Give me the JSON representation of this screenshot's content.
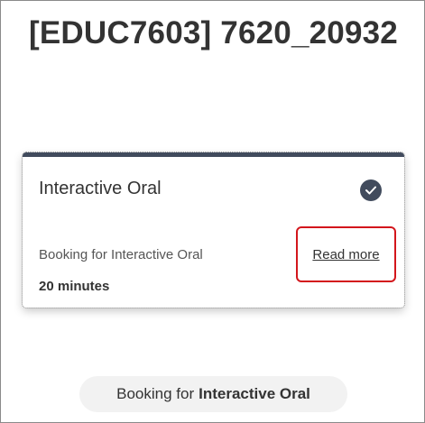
{
  "header": {
    "title": "[EDUC7603] 7620_20932"
  },
  "card": {
    "title": "Interactive Oral",
    "description": "Booking for Interactive Oral",
    "read_more": "Read more",
    "duration": "20 minutes",
    "selected_icon": "check-circle-icon",
    "accent_color": "#414b5d",
    "highlight_color": "#d3161c"
  },
  "footer": {
    "prefix": "Booking for",
    "service": "Interactive Oral"
  }
}
